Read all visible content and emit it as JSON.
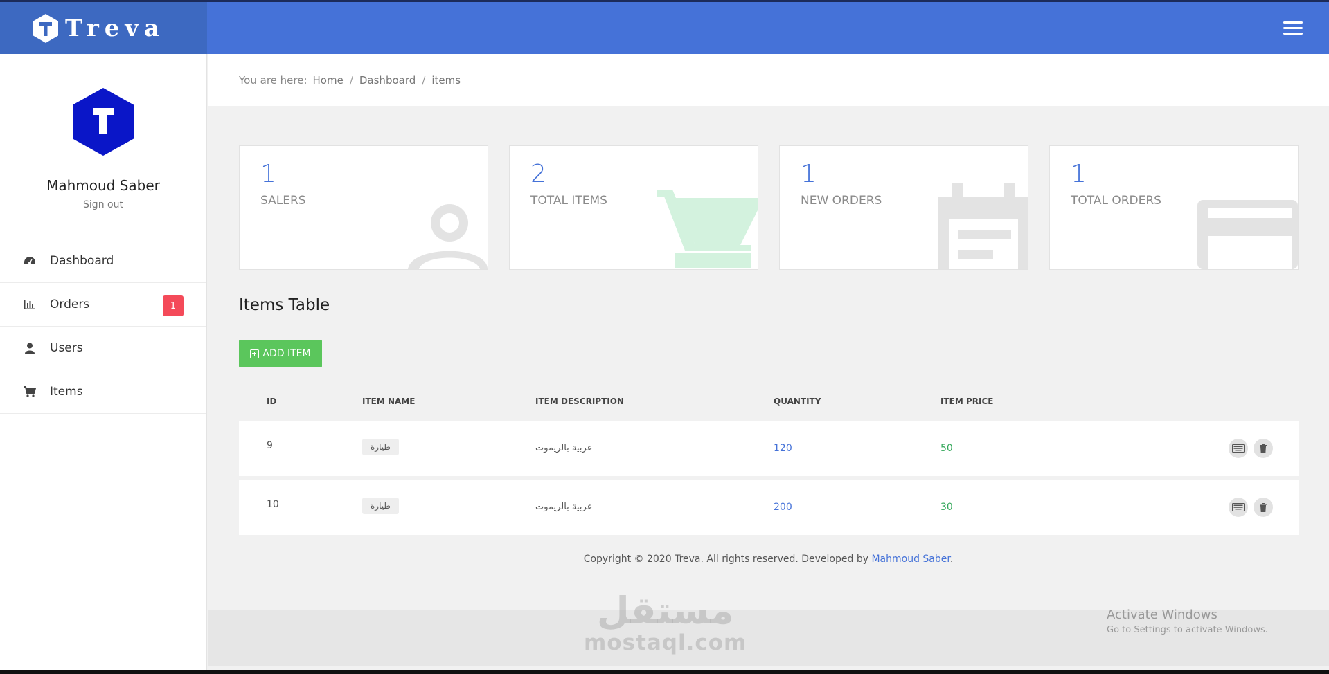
{
  "brand": {
    "name": "Treva"
  },
  "user": {
    "name": "Mahmoud Saber",
    "signout": "Sign out"
  },
  "sidebar": {
    "items": [
      {
        "label": "Dashboard",
        "icon": "dashboard-icon"
      },
      {
        "label": "Orders",
        "icon": "bar-chart-icon",
        "badge": "1"
      },
      {
        "label": "Users",
        "icon": "user-icon"
      },
      {
        "label": "Items",
        "icon": "cart-icon"
      }
    ]
  },
  "breadcrumb": {
    "lead": "You are here:",
    "items": [
      "Home",
      "Dashboard",
      "items"
    ]
  },
  "stats": [
    {
      "value": "1",
      "label": "SALERS",
      "icon": "user-icon"
    },
    {
      "value": "2",
      "label": "TOTAL ITEMS",
      "icon": "cart-icon"
    },
    {
      "value": "1",
      "label": "NEW ORDERS",
      "icon": "calendar-icon"
    },
    {
      "value": "1",
      "label": "TOTAL ORDERS",
      "icon": "credit-card-icon"
    }
  ],
  "table": {
    "title": "Items Table",
    "add_label": "ADD ITEM",
    "headers": [
      "ID",
      "ITEM NAME",
      "ITEM DESCRIPTION",
      "QUANTITY",
      "ITEM PRICE"
    ],
    "rows": [
      {
        "id": "9",
        "name": "طيارة",
        "description": "عربية بالريموت",
        "quantity": "120",
        "price": "50"
      },
      {
        "id": "10",
        "name": "طيارة",
        "description": "عربية بالريموت",
        "quantity": "200",
        "price": "30"
      }
    ]
  },
  "footer": {
    "text": "Copyright © 2020 Treva. All rights reserved. Developed by ",
    "link": "Mahmoud Saber",
    "suffix": "."
  },
  "watermark": {
    "arabic": "مستقل",
    "latin": "mostaql.com"
  },
  "windows": {
    "line1": "Activate Windows",
    "line2": "Go to Settings to activate Windows."
  },
  "colors": {
    "primary": "#4572d8",
    "brand_bar": "#3d69c1",
    "success": "#5bc65c",
    "danger": "#f44a59"
  }
}
